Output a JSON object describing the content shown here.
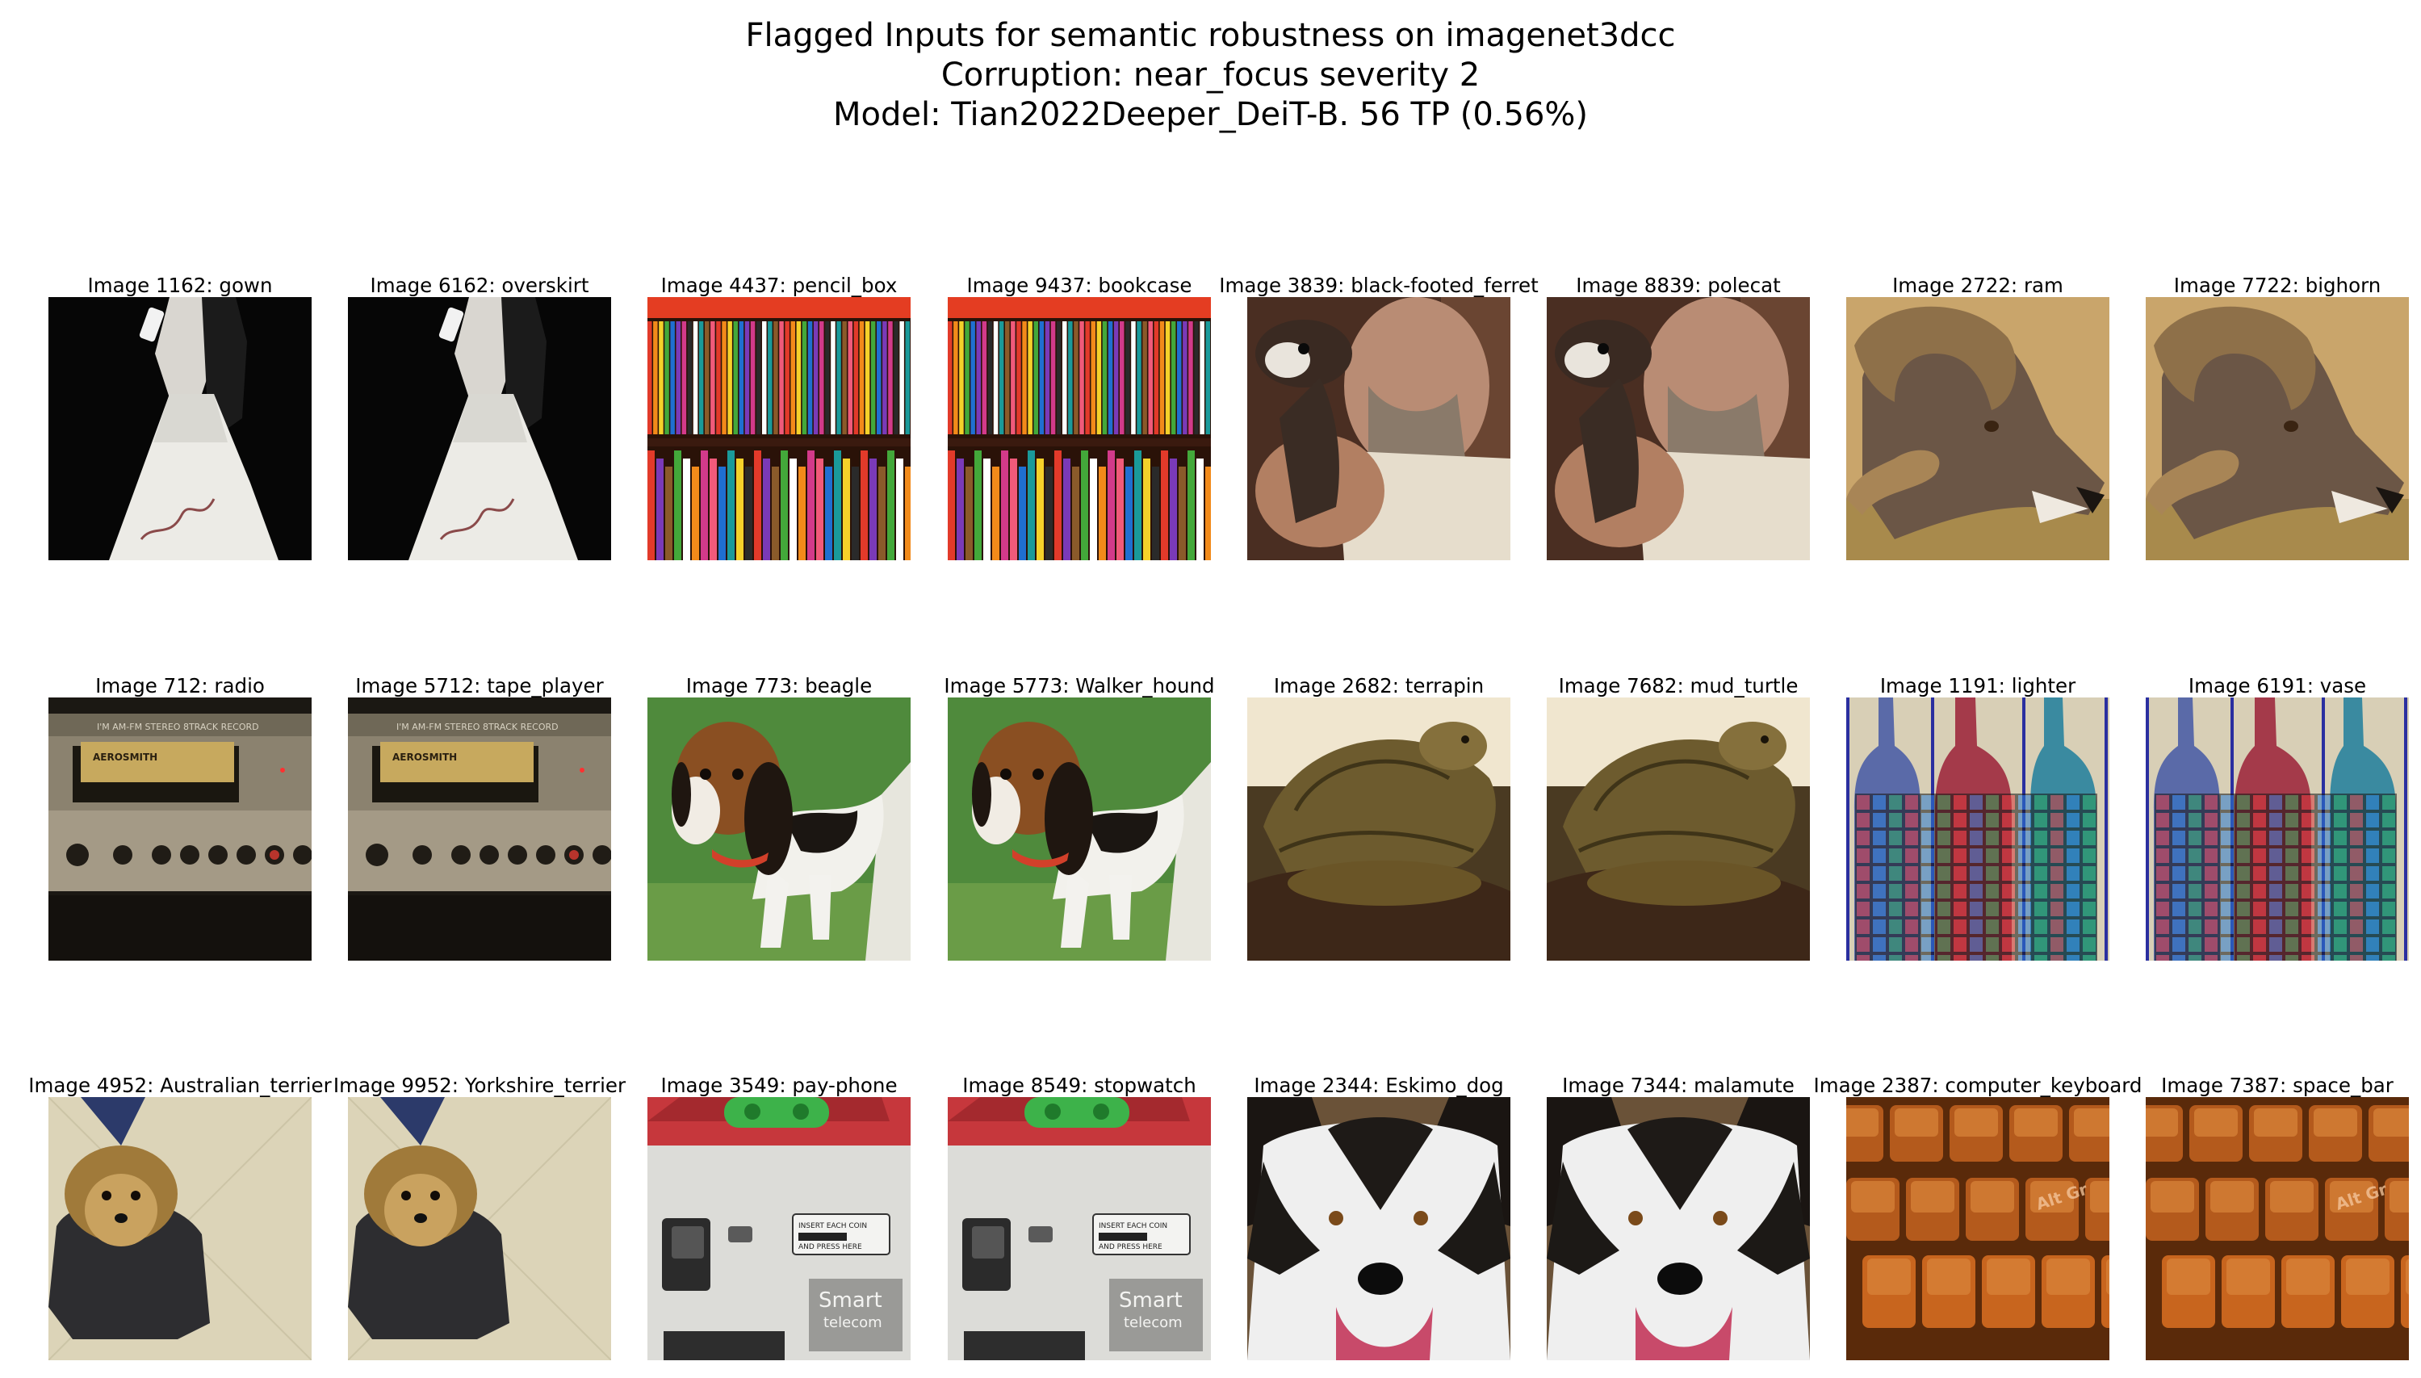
{
  "figure": {
    "title_lines": [
      "Flagged Inputs for semantic robustness on imagenet3dcc",
      "Corruption: near_focus severity 2",
      "Model: Tian2022Deeper_DeiT-B. 56 TP (0.56%)"
    ]
  },
  "grid": {
    "rows": [
      [
        {
          "caption": "Image 1162: gown",
          "scene": "gown"
        },
        {
          "caption": "Image 6162: overskirt",
          "scene": "gown"
        },
        {
          "caption": "Image 4437: pencil_box",
          "scene": "pencils"
        },
        {
          "caption": "Image 9437: bookcase",
          "scene": "pencils"
        },
        {
          "caption": "Image 3839: black-footed_ferret",
          "scene": "ferret"
        },
        {
          "caption": "Image 8839: polecat",
          "scene": "ferret"
        },
        {
          "caption": "Image 2722: ram",
          "scene": "ram"
        },
        {
          "caption": "Image 7722: bighorn",
          "scene": "ram"
        }
      ],
      [
        {
          "caption": "Image 712: radio",
          "scene": "radio"
        },
        {
          "caption": "Image 5712: tape_player",
          "scene": "radio"
        },
        {
          "caption": "Image 773: beagle",
          "scene": "beagle"
        },
        {
          "caption": "Image 5773: Walker_hound",
          "scene": "beagle"
        },
        {
          "caption": "Image 2682: terrapin",
          "scene": "turtle"
        },
        {
          "caption": "Image 7682: mud_turtle",
          "scene": "turtle"
        },
        {
          "caption": "Image 1191: lighter",
          "scene": "bottles"
        },
        {
          "caption": "Image 6191: vase",
          "scene": "bottles"
        }
      ],
      [
        {
          "caption": "Image 4952: Australian_terrier",
          "scene": "terrier"
        },
        {
          "caption": "Image 9952: Yorkshire_terrier",
          "scene": "terrier"
        },
        {
          "caption": "Image 3549: pay-phone",
          "scene": "payphone"
        },
        {
          "caption": "Image 8549: stopwatch",
          "scene": "payphone"
        },
        {
          "caption": "Image 2344: Eskimo_dog",
          "scene": "husky"
        },
        {
          "caption": "Image 7344: malamute",
          "scene": "husky"
        },
        {
          "caption": "Image 2387: computer_keyboard",
          "scene": "keyboard"
        },
        {
          "caption": "Image 7387: space_bar",
          "scene": "keyboard"
        }
      ]
    ],
    "embedded_text": {
      "radio_header": "I'M AM-FM STEREO 8TRACK RECORD",
      "radio_label": "AEROSMITH",
      "payphone_notice_1": "INSERT EACH COIN",
      "payphone_notice_2": "AND PRESS HERE",
      "payphone_brand_1": "Smart",
      "payphone_brand_2": "telecom",
      "keyboard_key": "Alt Gr"
    }
  }
}
